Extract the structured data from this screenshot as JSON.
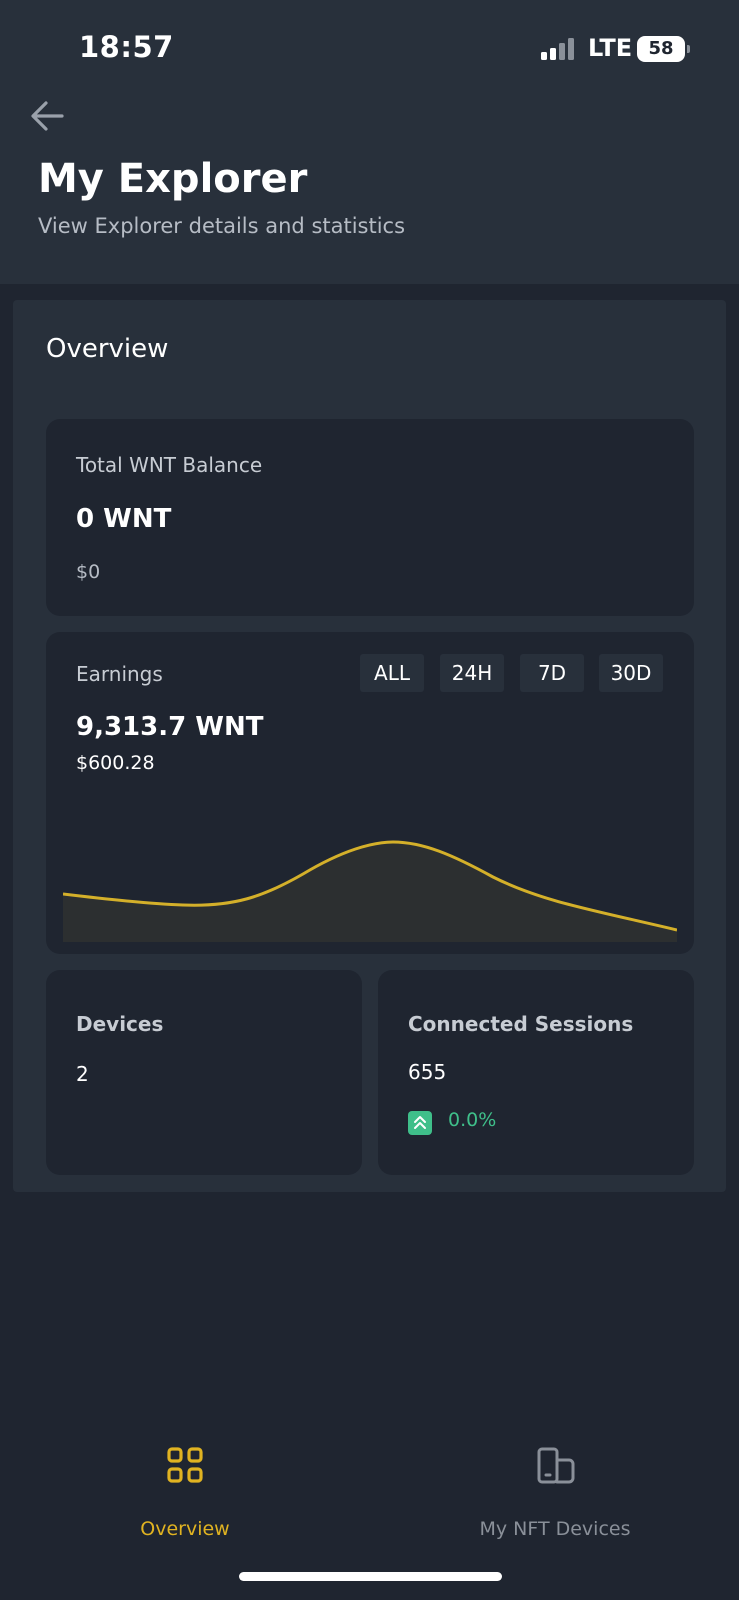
{
  "status_bar": {
    "time": "18:57",
    "network": "LTE",
    "battery": "58"
  },
  "header": {
    "title": "My Explorer",
    "subtitle": "View Explorer details and statistics"
  },
  "overview": {
    "title": "Overview",
    "balance": {
      "label": "Total WNT Balance",
      "amount": "0 WNT",
      "fiat": "$0"
    },
    "earnings": {
      "label": "Earnings",
      "amount": "9,313.7 WNT",
      "fiat": "$600.28",
      "ranges": [
        "ALL",
        "24H",
        "7D",
        "30D"
      ]
    },
    "devices": {
      "label": "Devices",
      "value": "2"
    },
    "sessions": {
      "label": "Connected Sessions",
      "value": "655",
      "change": "0.0%"
    }
  },
  "tabs": [
    {
      "label": "Overview",
      "active": true,
      "icon": "grid-icon"
    },
    {
      "label": "My NFT Devices",
      "active": false,
      "icon": "devices-icon"
    }
  ],
  "colors": {
    "accent": "#e0b321",
    "positive": "#3fbf8a",
    "background": "#1f2530",
    "header": "#28303b"
  }
}
